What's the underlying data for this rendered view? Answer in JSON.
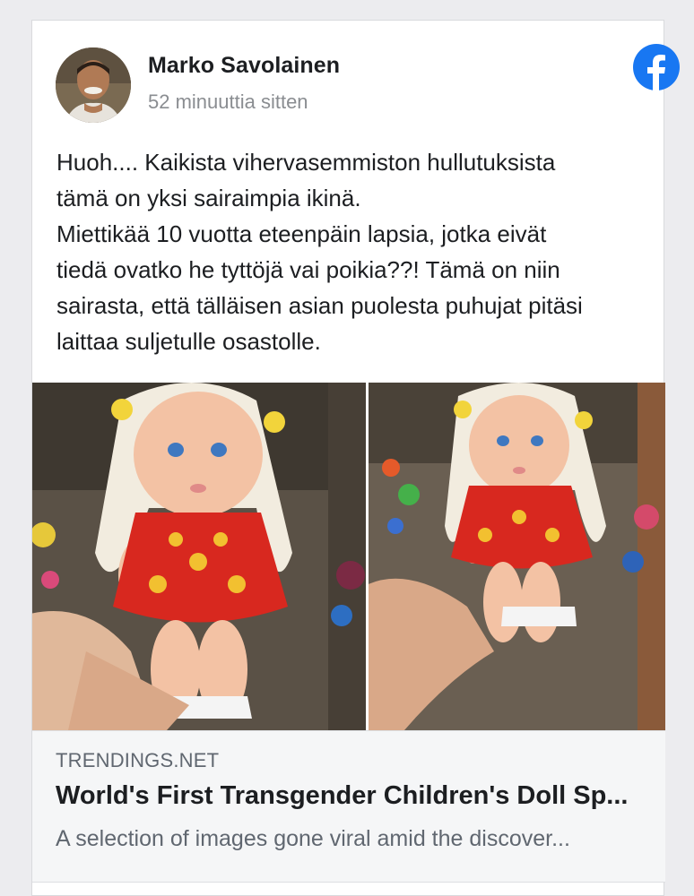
{
  "post": {
    "author": "Marko Savolainen",
    "timestamp": "52 minuuttia sitten",
    "text_lines": [
      "Huoh.... Kaikista vihervasemmiston hullutuksista",
      "tämä on yksi sairaimpia ikinä.",
      "Miettikää 10 vuotta eteenpäin lapsia, jotka eivät",
      "tiedä ovatko he tyttöjä vai poikia??! Tämä on niin",
      "sairasta, että tälläisen asian puolesta puhujat pitäsi",
      "laittaa suljetulle osastolle."
    ]
  },
  "link_preview": {
    "domain": "TRENDINGS.NET",
    "title": "World's First Transgender Children's Doll Sp...",
    "description": "A selection of images gone viral amid the discover..."
  },
  "icons": {
    "facebook": "facebook-logo-icon"
  },
  "colors": {
    "facebook_blue": "#1877f2",
    "text_primary": "#1c1e21",
    "text_secondary": "#8a8d91"
  }
}
